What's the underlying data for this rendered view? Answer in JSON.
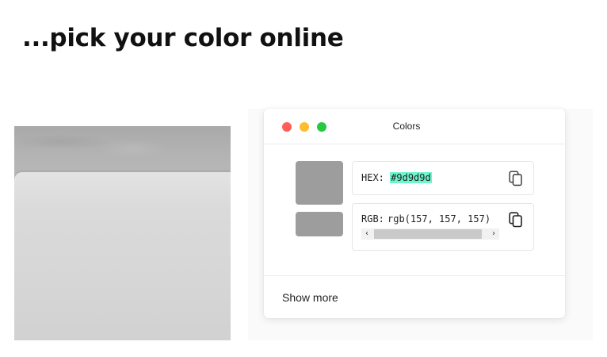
{
  "page": {
    "headline": "...pick your color online"
  },
  "window": {
    "title": "Colors",
    "controls": [
      "close",
      "minimize",
      "zoom"
    ]
  },
  "picker": {
    "selected_color": "#9d9d9d",
    "hex": {
      "label": "HEX:",
      "value": "#9d9d9d",
      "highlight_color": "#6df5cc",
      "copy_icon": "copy-icon"
    },
    "rgb": {
      "label": "RGB:",
      "value": "rgb(157, 157, 157)",
      "copy_icon": "copy-icon"
    },
    "show_more_label": "Show more"
  }
}
